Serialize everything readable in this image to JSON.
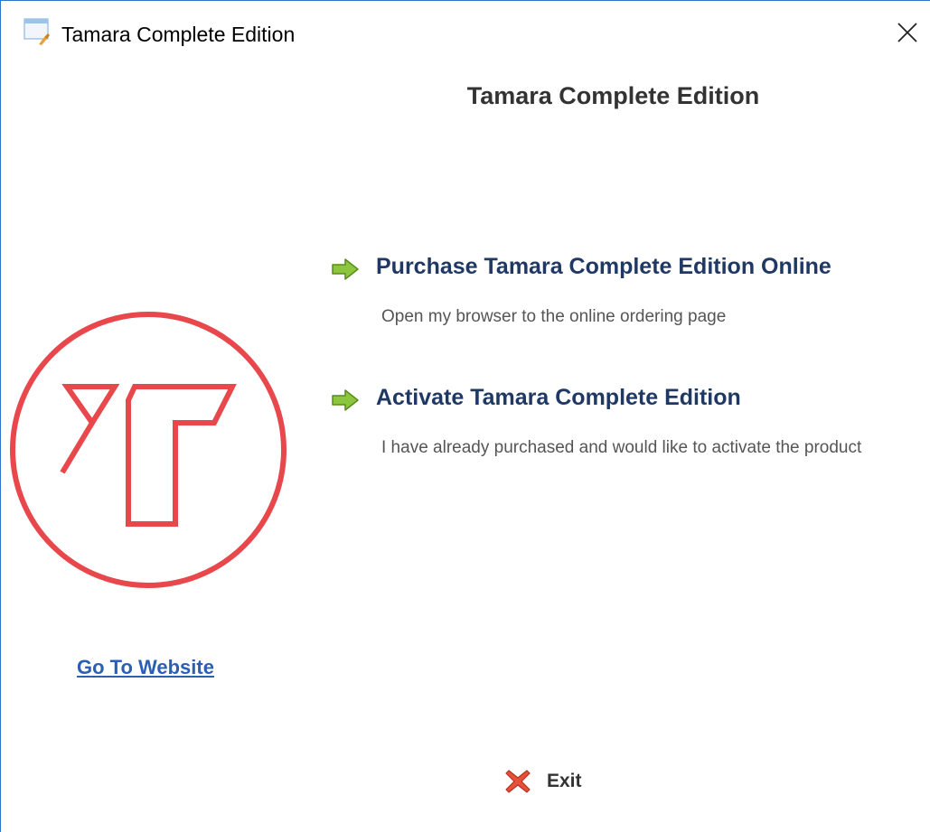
{
  "window": {
    "title": "Tamara Complete Edition",
    "close_icon": "close-icon"
  },
  "heading": "Tamara Complete Edition",
  "logo": {
    "icon": "tamara-logo-icon",
    "color": "#e8474c"
  },
  "options": [
    {
      "title": "Purchase Tamara Complete Edition Online",
      "description": "Open my browser to the online ordering page",
      "icon": "green-arrow-icon"
    },
    {
      "title": "Activate Tamara Complete Edition",
      "description": "I have already purchased and would like to activate the product",
      "icon": "green-arrow-icon"
    }
  ],
  "website_link": "Go To Website",
  "exit": {
    "label": "Exit",
    "icon": "red-x-icon"
  },
  "colors": {
    "accent_title": "#1f3864",
    "link": "#2b5fb4",
    "arrow_green": "#8cc63f",
    "logo_red": "#e8474c",
    "window_border": "#2b78c9"
  }
}
